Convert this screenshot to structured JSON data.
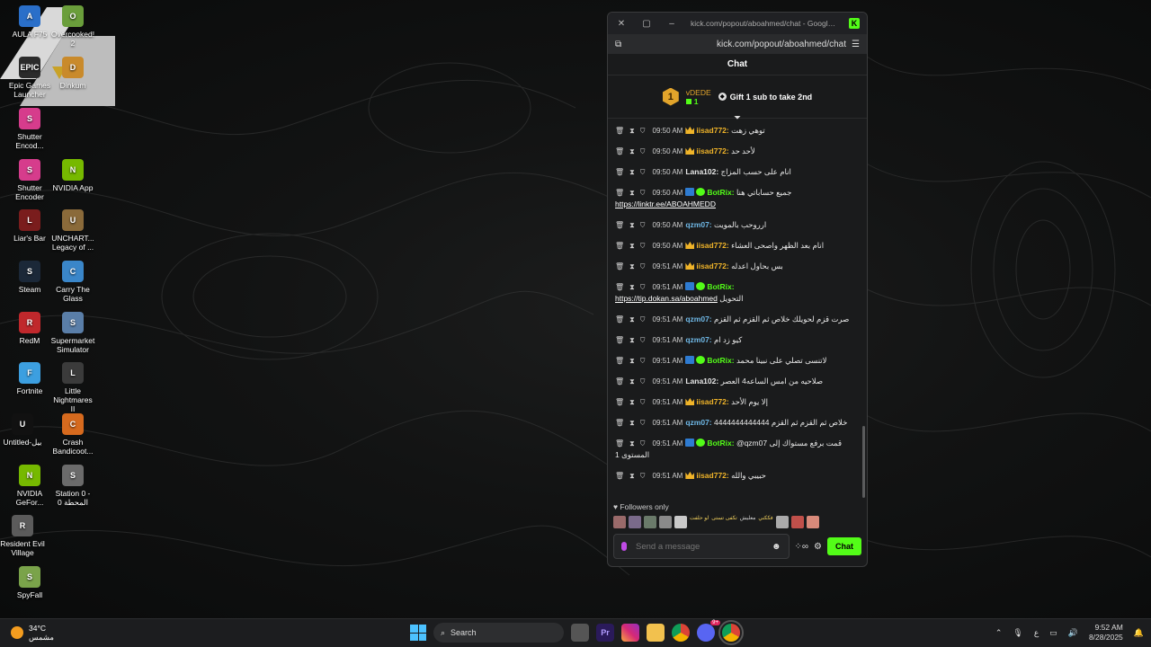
{
  "desktop": {
    "icons": [
      {
        "label": "AULA F75",
        "color": "#2a6fc9",
        "glyph": "A"
      },
      {
        "label": "Overcooked! 2",
        "color": "#6a9e3b",
        "glyph": "O"
      },
      {
        "label": "Epic Games Launcher",
        "color": "#2b2b2b",
        "glyph": "EPIC"
      },
      {
        "label": "Dinkum",
        "color": "#c98a2b",
        "glyph": "D"
      },
      {
        "label": "Shutter Encod...",
        "color": "#d63c8c",
        "glyph": "S"
      },
      {
        "label": "Shutter Encoder",
        "color": "#d63c8c",
        "glyph": "S"
      },
      {
        "label": "NVIDIA App",
        "color": "#76b900",
        "glyph": "N"
      },
      {
        "label": "Liar's Bar",
        "color": "#7a1d1d",
        "glyph": "L"
      },
      {
        "label": "UNCHART... Legacy of ...",
        "color": "#8a6a3a",
        "glyph": "U"
      },
      {
        "label": "Steam",
        "color": "#1b2838",
        "glyph": "S"
      },
      {
        "label": "Carry The Glass",
        "color": "#3a86c9",
        "glyph": "C"
      },
      {
        "label": "RedM",
        "color": "#c0282c",
        "glyph": "R"
      },
      {
        "label": "Supermarket Simulator",
        "color": "#5a7ea8",
        "glyph": "S"
      },
      {
        "label": "Fortnite",
        "color": "#3c9fe0",
        "glyph": "F"
      },
      {
        "label": "Little Nightmares II",
        "color": "#3b3b3b",
        "glyph": "L"
      },
      {
        "label": "Untitled-بيل",
        "color": "#111111",
        "glyph": "U"
      },
      {
        "label": "Crash Bandicoot...",
        "color": "#d66a1e",
        "glyph": "C"
      },
      {
        "label": "NVIDIA GeFor...",
        "color": "#76b900",
        "glyph": "N"
      },
      {
        "label": "Station 0 - المحطة 0",
        "color": "#6b6b6b",
        "glyph": "S"
      },
      {
        "label": "Resident Evil Village",
        "color": "#5b5b5b",
        "glyph": "R"
      },
      {
        "label": "SpyFall",
        "color": "#7aa34a",
        "glyph": "S"
      }
    ]
  },
  "window": {
    "title": "kick.com/popout/aboahmed/chat - Google Chro...",
    "url": "kick.com/popout/aboahmed/chat",
    "brand_color": "#53fc18"
  },
  "chat": {
    "header": "Chat",
    "pinned": {
      "rank": "1",
      "user": "vDEDE",
      "count": "1",
      "gift_text": "Gift 1 sub to take 2nd"
    },
    "messages": [
      {
        "time": "09:50 AM",
        "badges": [
          "crown"
        ],
        "user": "iisad772:",
        "user_color": "#f0b429",
        "text": "توهي زهت"
      },
      {
        "time": "09:50 AM",
        "badges": [
          "crown"
        ],
        "user": "iisad772:",
        "user_color": "#f0b429",
        "text": "لأحد حد"
      },
      {
        "time": "09:50 AM",
        "badges": [],
        "user": "Lana102:",
        "user_color": "#e8e8e8",
        "text": "انام على حسب المزاج"
      },
      {
        "time": "09:50 AM",
        "badges": [
          "bot",
          "verified"
        ],
        "user": "BotRix:",
        "user_color": "#53fc18",
        "text": "جميع حساباتي هنا",
        "link": "https://linktr.ee/ABOAHMEDD"
      },
      {
        "time": "09:50 AM",
        "badges": [],
        "user": "qzm07:",
        "user_color": "#6fb8e6",
        "text": "ارروحب بالمويت"
      },
      {
        "time": "09:50 AM",
        "badges": [
          "crown"
        ],
        "user": "iisad772:",
        "user_color": "#f0b429",
        "text": "انام بعد الظهر واصحى العشاء"
      },
      {
        "time": "09:51 AM",
        "badges": [
          "crown"
        ],
        "user": "iisad772:",
        "user_color": "#f0b429",
        "text": "بس بحاول اعدله"
      },
      {
        "time": "09:51 AM",
        "badges": [
          "bot",
          "verified"
        ],
        "user": "BotRix:",
        "user_color": "#53fc18",
        "text": "",
        "link": "https://tip.dokan.sa/aboahmed",
        "suffix": "التحويل"
      },
      {
        "time": "09:51 AM",
        "badges": [],
        "user": "qzm07:",
        "user_color": "#6fb8e6",
        "text": "صرت قزم لحويلك خلاص ثم القزم ثم القزم"
      },
      {
        "time": "09:51 AM",
        "badges": [],
        "user": "qzm07:",
        "user_color": "#6fb8e6",
        "text": "كيو زد ام"
      },
      {
        "time": "09:51 AM",
        "badges": [
          "bot",
          "verified"
        ],
        "user": "BotRix:",
        "user_color": "#53fc18",
        "text": "لاتنسى تصلي على نبينا محمد"
      },
      {
        "time": "09:51 AM",
        "badges": [],
        "user": "Lana102:",
        "user_color": "#e8e8e8",
        "text": "صلاحيه من امس الساعه4 العصر"
      },
      {
        "time": "09:51 AM",
        "badges": [
          "crown"
        ],
        "user": "iisad772:",
        "user_color": "#f0b429",
        "text": "إلا يوم الأحد"
      },
      {
        "time": "09:51 AM",
        "badges": [],
        "user": "qzm07:",
        "user_color": "#6fb8e6",
        "text": "خلاص ثم القزم ثم القزم 4444444444444"
      },
      {
        "time": "09:51 AM",
        "badges": [
          "bot",
          "verified"
        ],
        "user": "BotRix:",
        "user_color": "#53fc18",
        "text": "@qzm07 قمت برفع مستواك إلى المستوى 1"
      },
      {
        "time": "09:51 AM",
        "badges": [
          "crown"
        ],
        "user": "iisad772:",
        "user_color": "#f0b429",
        "text": "حبيبي والله"
      }
    ],
    "followers_only": "Followers only",
    "emote_text_1": "لو حلفت",
    "emote_text_2": "تكفى تستى",
    "emote_text_3": "معليش",
    "emote_text_4": "فككني",
    "input_placeholder": "Send a message",
    "send_label": "Chat"
  },
  "taskbar": {
    "weather_temp": "34°C",
    "weather_desc": "مشمس",
    "search_label": "Search",
    "lang": "ع",
    "time": "9:52 AM",
    "date": "8/28/2025",
    "notification_count": "9+"
  }
}
